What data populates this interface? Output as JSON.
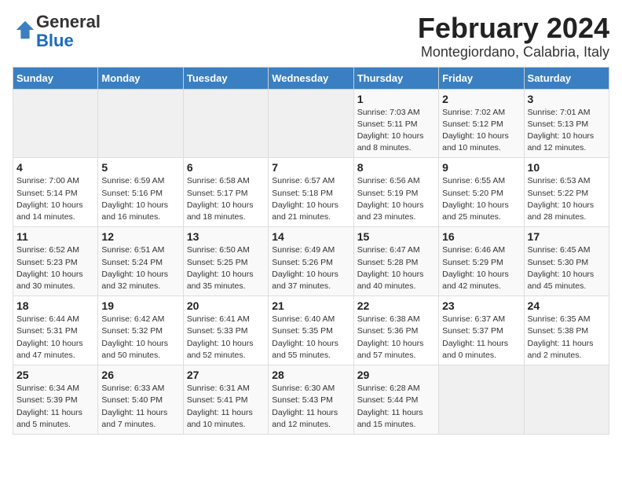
{
  "logo": {
    "general": "General",
    "blue": "Blue"
  },
  "title": "February 2024",
  "subtitle": "Montegiordano, Calabria, Italy",
  "days_of_week": [
    "Sunday",
    "Monday",
    "Tuesday",
    "Wednesday",
    "Thursday",
    "Friday",
    "Saturday"
  ],
  "weeks": [
    [
      {
        "day": "",
        "info": ""
      },
      {
        "day": "",
        "info": ""
      },
      {
        "day": "",
        "info": ""
      },
      {
        "day": "",
        "info": ""
      },
      {
        "day": "1",
        "info": "Sunrise: 7:03 AM\nSunset: 5:11 PM\nDaylight: 10 hours\nand 8 minutes."
      },
      {
        "day": "2",
        "info": "Sunrise: 7:02 AM\nSunset: 5:12 PM\nDaylight: 10 hours\nand 10 minutes."
      },
      {
        "day": "3",
        "info": "Sunrise: 7:01 AM\nSunset: 5:13 PM\nDaylight: 10 hours\nand 12 minutes."
      }
    ],
    [
      {
        "day": "4",
        "info": "Sunrise: 7:00 AM\nSunset: 5:14 PM\nDaylight: 10 hours\nand 14 minutes."
      },
      {
        "day": "5",
        "info": "Sunrise: 6:59 AM\nSunset: 5:16 PM\nDaylight: 10 hours\nand 16 minutes."
      },
      {
        "day": "6",
        "info": "Sunrise: 6:58 AM\nSunset: 5:17 PM\nDaylight: 10 hours\nand 18 minutes."
      },
      {
        "day": "7",
        "info": "Sunrise: 6:57 AM\nSunset: 5:18 PM\nDaylight: 10 hours\nand 21 minutes."
      },
      {
        "day": "8",
        "info": "Sunrise: 6:56 AM\nSunset: 5:19 PM\nDaylight: 10 hours\nand 23 minutes."
      },
      {
        "day": "9",
        "info": "Sunrise: 6:55 AM\nSunset: 5:20 PM\nDaylight: 10 hours\nand 25 minutes."
      },
      {
        "day": "10",
        "info": "Sunrise: 6:53 AM\nSunset: 5:22 PM\nDaylight: 10 hours\nand 28 minutes."
      }
    ],
    [
      {
        "day": "11",
        "info": "Sunrise: 6:52 AM\nSunset: 5:23 PM\nDaylight: 10 hours\nand 30 minutes."
      },
      {
        "day": "12",
        "info": "Sunrise: 6:51 AM\nSunset: 5:24 PM\nDaylight: 10 hours\nand 32 minutes."
      },
      {
        "day": "13",
        "info": "Sunrise: 6:50 AM\nSunset: 5:25 PM\nDaylight: 10 hours\nand 35 minutes."
      },
      {
        "day": "14",
        "info": "Sunrise: 6:49 AM\nSunset: 5:26 PM\nDaylight: 10 hours\nand 37 minutes."
      },
      {
        "day": "15",
        "info": "Sunrise: 6:47 AM\nSunset: 5:28 PM\nDaylight: 10 hours\nand 40 minutes."
      },
      {
        "day": "16",
        "info": "Sunrise: 6:46 AM\nSunset: 5:29 PM\nDaylight: 10 hours\nand 42 minutes."
      },
      {
        "day": "17",
        "info": "Sunrise: 6:45 AM\nSunset: 5:30 PM\nDaylight: 10 hours\nand 45 minutes."
      }
    ],
    [
      {
        "day": "18",
        "info": "Sunrise: 6:44 AM\nSunset: 5:31 PM\nDaylight: 10 hours\nand 47 minutes."
      },
      {
        "day": "19",
        "info": "Sunrise: 6:42 AM\nSunset: 5:32 PM\nDaylight: 10 hours\nand 50 minutes."
      },
      {
        "day": "20",
        "info": "Sunrise: 6:41 AM\nSunset: 5:33 PM\nDaylight: 10 hours\nand 52 minutes."
      },
      {
        "day": "21",
        "info": "Sunrise: 6:40 AM\nSunset: 5:35 PM\nDaylight: 10 hours\nand 55 minutes."
      },
      {
        "day": "22",
        "info": "Sunrise: 6:38 AM\nSunset: 5:36 PM\nDaylight: 10 hours\nand 57 minutes."
      },
      {
        "day": "23",
        "info": "Sunrise: 6:37 AM\nSunset: 5:37 PM\nDaylight: 11 hours\nand 0 minutes."
      },
      {
        "day": "24",
        "info": "Sunrise: 6:35 AM\nSunset: 5:38 PM\nDaylight: 11 hours\nand 2 minutes."
      }
    ],
    [
      {
        "day": "25",
        "info": "Sunrise: 6:34 AM\nSunset: 5:39 PM\nDaylight: 11 hours\nand 5 minutes."
      },
      {
        "day": "26",
        "info": "Sunrise: 6:33 AM\nSunset: 5:40 PM\nDaylight: 11 hours\nand 7 minutes."
      },
      {
        "day": "27",
        "info": "Sunrise: 6:31 AM\nSunset: 5:41 PM\nDaylight: 11 hours\nand 10 minutes."
      },
      {
        "day": "28",
        "info": "Sunrise: 6:30 AM\nSunset: 5:43 PM\nDaylight: 11 hours\nand 12 minutes."
      },
      {
        "day": "29",
        "info": "Sunrise: 6:28 AM\nSunset: 5:44 PM\nDaylight: 11 hours\nand 15 minutes."
      },
      {
        "day": "",
        "info": ""
      },
      {
        "day": "",
        "info": ""
      }
    ]
  ]
}
